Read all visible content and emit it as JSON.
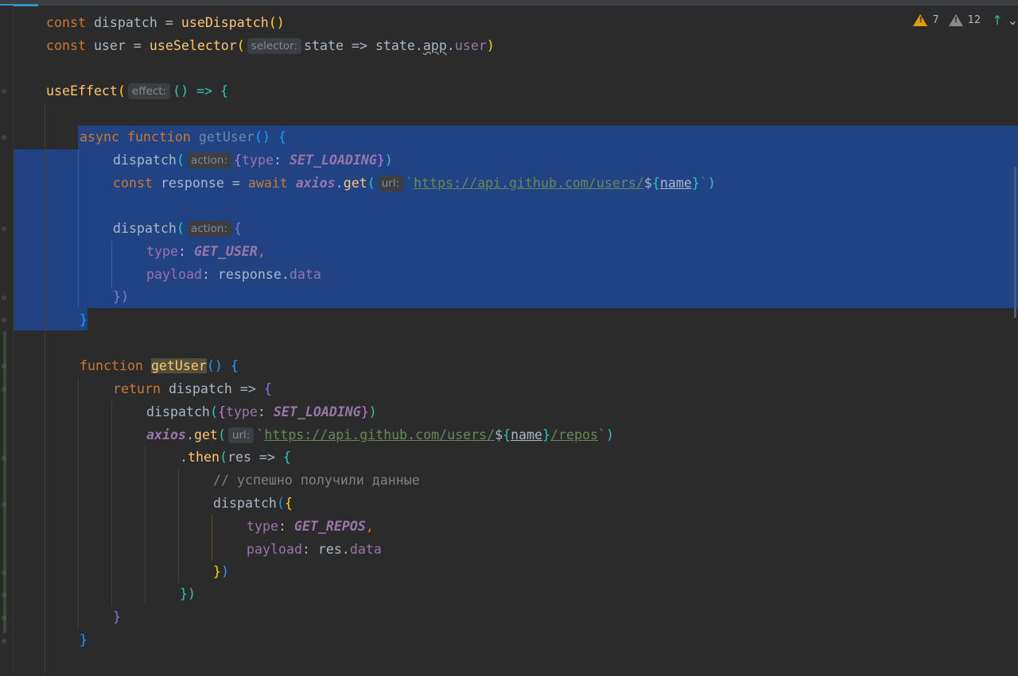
{
  "status": {
    "warnings_count": "7",
    "weak_warnings_count": "12",
    "prev_highlight_icon": "↑",
    "next_highlight_icon": "⌄"
  },
  "code": {
    "l1_a": "const",
    "l1_b": " dispatch = ",
    "l1_c": "useDispatch",
    "l1_d": "()",
    "l2_a": "const",
    "l2_b": " user = ",
    "l2_c": "useSelector",
    "l2_d": "(",
    "l2_hint": "selector:",
    "l2_e": "state => state.",
    "l2_f": "app",
    "l2_g": ".",
    "l2_h": "user",
    "l2_i": ")",
    "l3_a": "useEffect",
    "l3_b": "(",
    "l3_hint": "effect:",
    "l3_c": "() => {",
    "l4_a": "async",
    "l4_b": " ",
    "l4_c": "function",
    "l4_d": " ",
    "l4_e": "getUser",
    "l4_f": "() ",
    "l4_g": "{",
    "l5_a": "dispatch",
    "l5_b": "(",
    "l5_hint": "action:",
    "l5_c": "{",
    "l5_d": "type",
    "l5_e": ": ",
    "l5_f": "SET_LOADING",
    "l5_g": "}",
    "l5_h": ")",
    "l6_a": "const",
    "l6_b": " response = ",
    "l6_c": "await",
    "l6_d": " ",
    "l6_e": "axios",
    "l6_f": ".",
    "l6_g": "get",
    "l6_h": "(",
    "l6_hint": "url:",
    "l6_i": "`",
    "l6_j": "https://api.github.com/users/",
    "l6_k": "$",
    "l6_l": "{",
    "l6_m": "name",
    "l6_n": "}",
    "l6_o": "`",
    "l6_p": ")",
    "l8_a": "dispatch",
    "l8_b": "(",
    "l8_hint": "action:",
    "l8_c": "{",
    "l9_a": "type",
    "l9_b": ": ",
    "l9_c": "GET_USER",
    "l9_d": ",",
    "l10_a": "payload",
    "l10_b": ": response.",
    "l10_c": "data",
    "l11_a": "})",
    "l12_a": "}",
    "l13_a": "function",
    "l13_b": " ",
    "l13_c": "getUser",
    "l13_d": "() ",
    "l13_e": "{",
    "l14_a": "return",
    "l14_b": " dispatch => ",
    "l14_c": "{",
    "l15_a": "dispatch",
    "l15_b": "(",
    "l15_c": "{",
    "l15_d": "type",
    "l15_e": ": ",
    "l15_f": "SET_LOADING",
    "l15_g": "}",
    "l15_h": ")",
    "l16_a": "axios",
    "l16_b": ".",
    "l16_c": "get",
    "l16_d": "(",
    "l16_hint": "url:",
    "l16_e": "`",
    "l16_f": "https://api.github.com/users/",
    "l16_g": "$",
    "l16_h": "{",
    "l16_i": "name",
    "l16_j": "}",
    "l16_k": "/repos",
    "l16_l": "`",
    "l16_m": ")",
    "l17_a": ".",
    "l17_b": "then",
    "l17_c": "(",
    "l17_d": "res => ",
    "l17_e": "{",
    "l18_a": "// успешно получили данные",
    "l19_a": "dispatch",
    "l19_b": "(",
    "l19_c": "{",
    "l20_a": "type",
    "l20_b": ": ",
    "l20_c": "GET_REPOS",
    "l20_d": ",",
    "l21_a": "payload",
    "l21_b": ": res.",
    "l21_c": "data",
    "l22_a": "}",
    "l22_b": ")",
    "l23_a": "}",
    "l23_b": ")",
    "l24_a": "}",
    "l25_a": "}"
  }
}
